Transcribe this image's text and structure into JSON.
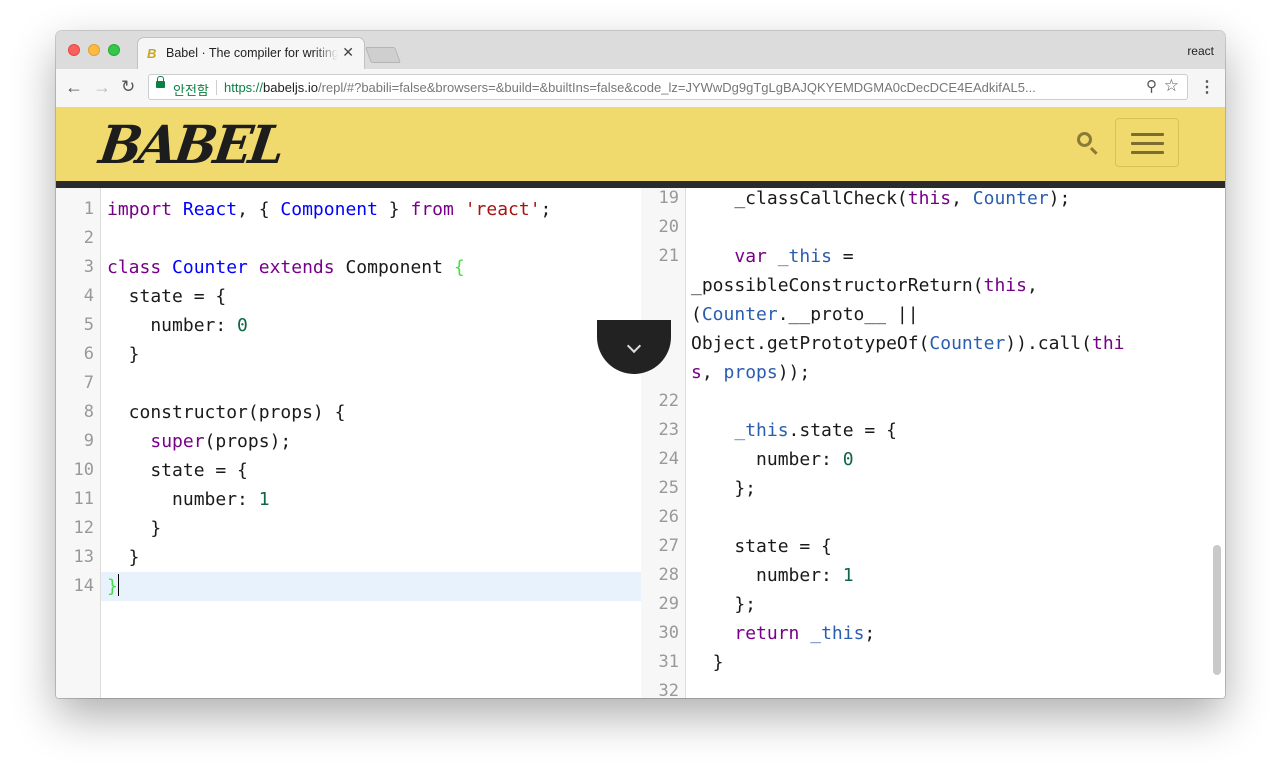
{
  "browser": {
    "tab_title": "Babel · The compiler for writing next generation JavaScript",
    "tab_favicon": "B",
    "tab_close": "✕",
    "profile_name": "react",
    "secure_label": "안전함",
    "url_scheme": "https://",
    "url_host": "babeljs.io",
    "url_path": "/repl/#?babili=false&browsers=&build=&builtIns=false&code_lz=JYWwDg9gTgLgBAJQKYEMDGMA0cDecDCE4EAdkifAL5..."
  },
  "site": {
    "logo": "BABEL"
  },
  "source": {
    "lines": [
      {
        "n": "1"
      },
      {
        "n": "2"
      },
      {
        "n": "3"
      },
      {
        "n": "4"
      },
      {
        "n": "5"
      },
      {
        "n": "6"
      },
      {
        "n": "7"
      },
      {
        "n": "8"
      },
      {
        "n": "9"
      },
      {
        "n": "10"
      },
      {
        "n": "11"
      },
      {
        "n": "12"
      },
      {
        "n": "13"
      },
      {
        "n": "14"
      }
    ],
    "tokens": {
      "l1_import": "import",
      "l1_react": "React",
      "l1_component": "Component",
      "l1_from": "from",
      "l1_str": "'react'",
      "l3_class": "class",
      "l3_counter": "Counter",
      "l3_extends": "extends",
      "l3_component": "Component",
      "l3_brace": "{",
      "l4_text": "  state = {",
      "l5_text": "    number: ",
      "l5_num": "0",
      "l6_text": "  }",
      "l8_text": "  constructor(props) {",
      "l9_super": "super",
      "l9_rest": "(props);",
      "l10_text": "    state = {",
      "l11_text": "      number: ",
      "l11_num": "1",
      "l12_text": "    }",
      "l13_text": "  }",
      "l14_brace": "}"
    }
  },
  "output": {
    "line_numbers": [
      "19",
      "20",
      "21",
      "22",
      "23",
      "24",
      "25",
      "26",
      "27",
      "28",
      "29",
      "30",
      "31",
      "32"
    ],
    "tokens": {
      "o19_a": "    _classCallCheck(",
      "o19_this": "this",
      "o19_b": ", ",
      "o19_counter": "Counter",
      "o19_c": ");",
      "o21_var": "var",
      "o21_this": "_this",
      "o21_eq": " =",
      "o21b_text": "_possibleConstructorReturn(",
      "o21b_this": "this",
      "o21b_end": ",",
      "o21c_open": "(",
      "o21c_counter": "Counter",
      "o21c_rest": ".__proto__ ||",
      "o21d_text": "Object.getPrototypeOf(",
      "o21d_counter": "Counter",
      "o21d_mid": ")).call(",
      "o21d_thi": "thi",
      "o21e_s": "s",
      "o21e_comma": ", ",
      "o21e_props": "props",
      "o21e_end": "));",
      "o23_this": "_this",
      "o23_rest": ".state = {",
      "o24_text": "      number: ",
      "o24_num": "0",
      "o25_text": "    };",
      "o27_text": "    state = {",
      "o28_text": "      number: ",
      "o28_num": "1",
      "o29_text": "    };",
      "o30_return": "return",
      "o30_this": "_this",
      "o30_end": ";",
      "o31_text": "  }"
    }
  }
}
